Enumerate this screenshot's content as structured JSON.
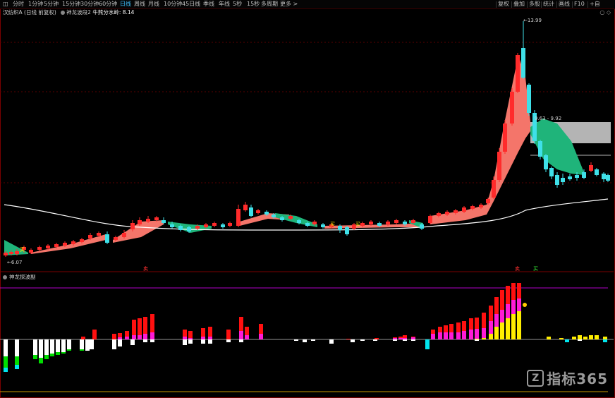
{
  "toolbar": {
    "left_items": [
      {
        "label": "◫",
        "active": false
      },
      {
        "label": "分时",
        "active": false
      },
      {
        "label": "1分钟",
        "active": false
      },
      {
        "label": "5分钟",
        "active": false
      },
      {
        "label": "15分钟",
        "active": false
      },
      {
        "label": "30分钟",
        "active": false
      },
      {
        "label": "60分钟",
        "active": false
      },
      {
        "label": "日线",
        "active": true
      },
      {
        "label": "周线",
        "active": false
      },
      {
        "label": "月线",
        "active": false
      },
      {
        "label": "10分钟",
        "active": false
      },
      {
        "label": "45日线",
        "active": false
      },
      {
        "label": "季线",
        "active": false
      },
      {
        "label": "年线",
        "active": false
      },
      {
        "label": "5秒",
        "active": false
      },
      {
        "label": "15秒",
        "active": false
      },
      {
        "label": "多周期",
        "active": false
      },
      {
        "label": "更多 >",
        "active": false
      }
    ],
    "right_items": [
      "复权",
      "叠加",
      "多股",
      "统计",
      "画线",
      "F10",
      "+自"
    ]
  },
  "main_legend": {
    "stock": "汉纺织A (日线 前复权)",
    "indicator": "神龙波段2",
    "ma_label": "牛熊分水岭:",
    "ma_value": "8.14"
  },
  "price_labels": {
    "high": "13.99",
    "low": "6.07",
    "range_box": "9.63 - 9.92"
  },
  "sub_indicator": {
    "name": "神龙探波副"
  },
  "markers": {
    "sell1": "卖",
    "sell2": "卖",
    "buy1": "买",
    "buy2": "买",
    "buy3": "买",
    "buy4": "买"
  },
  "colors": {
    "up": "#ff2b2b",
    "down": "#3fe0e8",
    "band_up": "#f4756a",
    "band_down": "#1fb47a",
    "ma": "#ffffff",
    "magenta": "#ff1bd6",
    "yellow": "#ffee00",
    "red": "#ff1010",
    "green": "#00dd00",
    "cyan": "#00e5ee",
    "purple_line": "#b000c8"
  },
  "logo": {
    "text": "指标365",
    "mark": "Z"
  }
}
